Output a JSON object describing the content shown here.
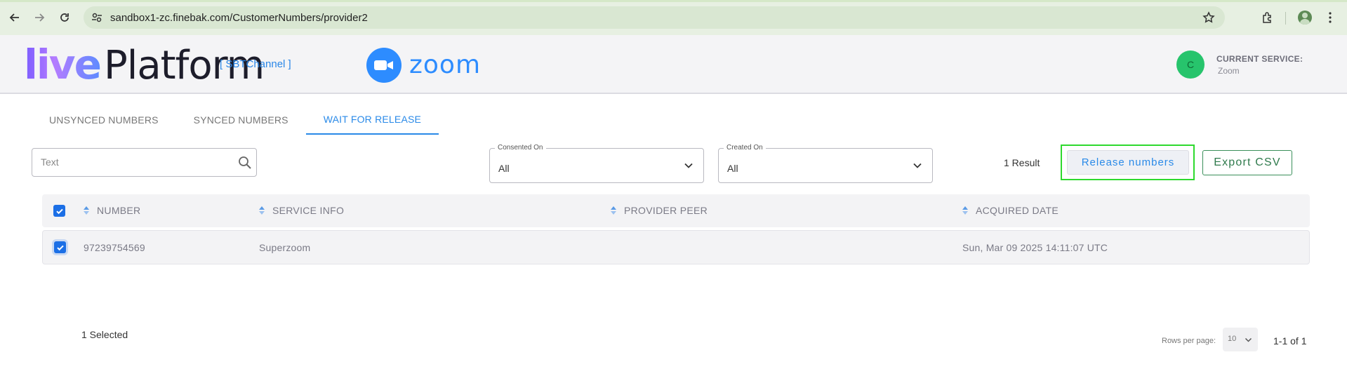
{
  "browser": {
    "url": "sandbox1-zc.finebak.com/CustomerNumbers/provider2"
  },
  "header": {
    "logo_live": "live",
    "logo_platform": "Platform",
    "channel_label": "[ SBTChannel ]",
    "zoom_label": "zoom",
    "service_avatar_letter": "C",
    "current_service_label": "CURRENT SERVICE:",
    "current_service_value": "Zoom"
  },
  "tabs": [
    {
      "label": "UNSYNCED NUMBERS",
      "active": false
    },
    {
      "label": "SYNCED NUMBERS",
      "active": false
    },
    {
      "label": "WAIT FOR RELEASE",
      "active": true
    }
  ],
  "filters": {
    "search_placeholder": "Text",
    "consented_on": {
      "legend": "Consented On",
      "value": "All"
    },
    "created_on": {
      "legend": "Created On",
      "value": "All"
    }
  },
  "toolbar": {
    "result_count": "1 Result",
    "release_label": "Release numbers",
    "export_label": "Export CSV"
  },
  "table": {
    "columns": [
      "NUMBER",
      "SERVICE INFO",
      "PROVIDER PEER",
      "ACQUIRED DATE"
    ],
    "rows": [
      {
        "number": "97239754569",
        "service_info": "Superzoom",
        "provider_peer": "",
        "acquired_date": "Sun, Mar 09 2025 14:11:07 UTC",
        "checked": true
      }
    ]
  },
  "footer": {
    "selected_count": "1 Selected",
    "rows_per_page_label": "Rows per page:",
    "rows_per_page_value": "10",
    "pagination": "1-1 of 1"
  },
  "colors": {
    "accent": "#2a8ae8",
    "checkbox": "#1c6fe6",
    "export_green": "#2f7a4c",
    "highlight_green": "#2ed92e",
    "avatar_green": "#27c46c"
  }
}
